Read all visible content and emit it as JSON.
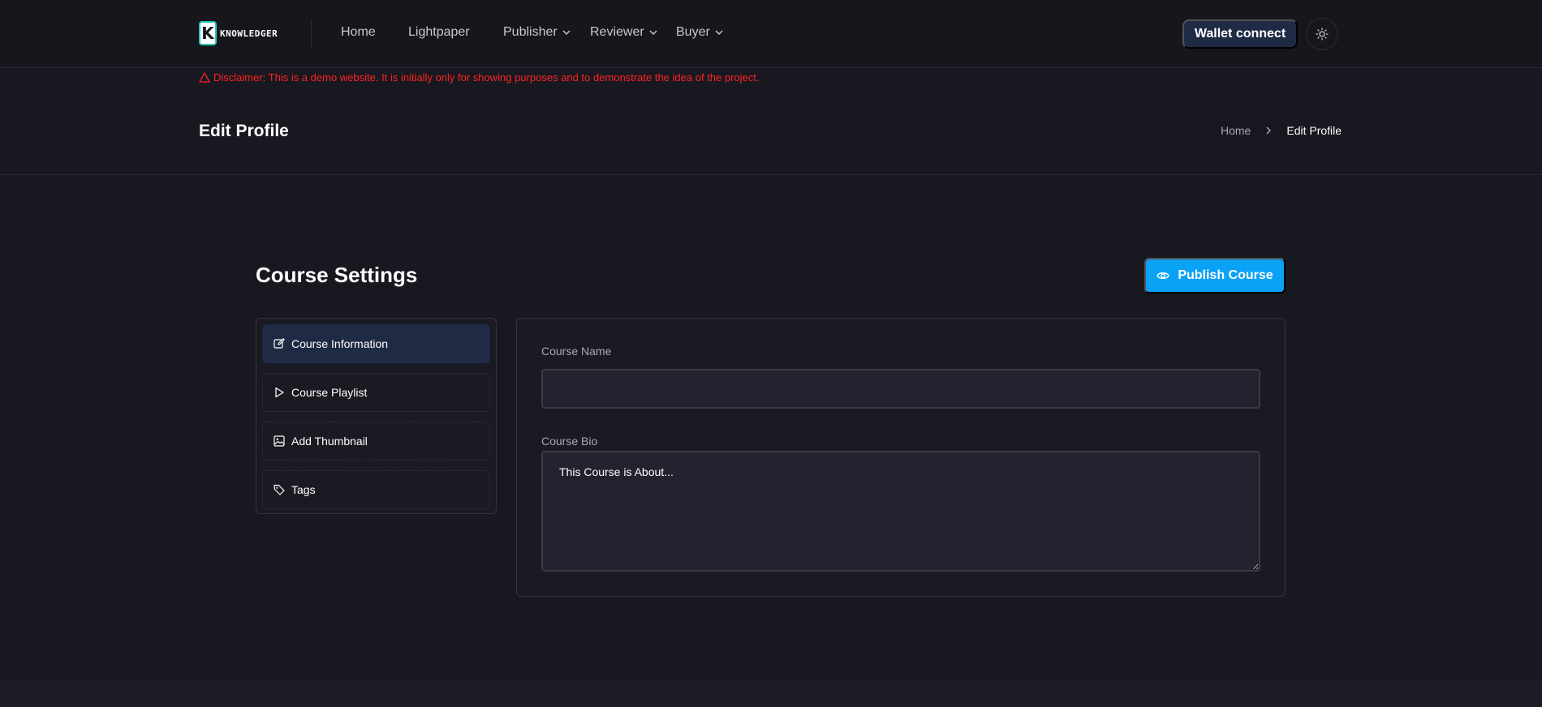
{
  "header": {
    "logo_text": "KNOWLEDGER",
    "logo_letter": "K",
    "nav": [
      {
        "label": "Home",
        "has_dropdown": false
      },
      {
        "label": "Lightpaper",
        "has_dropdown": false
      },
      {
        "label": "Publisher",
        "has_dropdown": true
      },
      {
        "label": "Reviewer",
        "has_dropdown": true
      },
      {
        "label": "Buyer",
        "has_dropdown": true
      }
    ],
    "wallet_button": "Wallet connect",
    "theme_icon": "sun-icon"
  },
  "disclaimer": {
    "icon": "warning-triangle-icon",
    "text": "Disclaimer: This is a demo website. It is initially only for showing purposes and to demonstrate the idea of the project."
  },
  "page_header": {
    "title": "Edit Profile",
    "breadcrumb": [
      "Home",
      "Edit Profile"
    ]
  },
  "course_settings": {
    "title": "Course Settings",
    "publish_button": "Publish Course",
    "menu": [
      {
        "label": "Course Information",
        "icon": "edit-icon",
        "active": true
      },
      {
        "label": "Course Playlist",
        "icon": "play-icon",
        "active": false
      },
      {
        "label": "Add Thumbnail",
        "icon": "image-icon",
        "active": false
      },
      {
        "label": "Tags",
        "icon": "tag-icon",
        "active": false
      }
    ],
    "form": {
      "course_name_label": "Course Name",
      "course_name_value": "",
      "course_bio_label": "Course Bio",
      "course_bio_placeholder": "This Course is About..."
    }
  },
  "colors": {
    "background": "#181820",
    "accent": "#0aa2f5",
    "active_item": "#1f2a44",
    "disclaimer": "#ff2222"
  }
}
